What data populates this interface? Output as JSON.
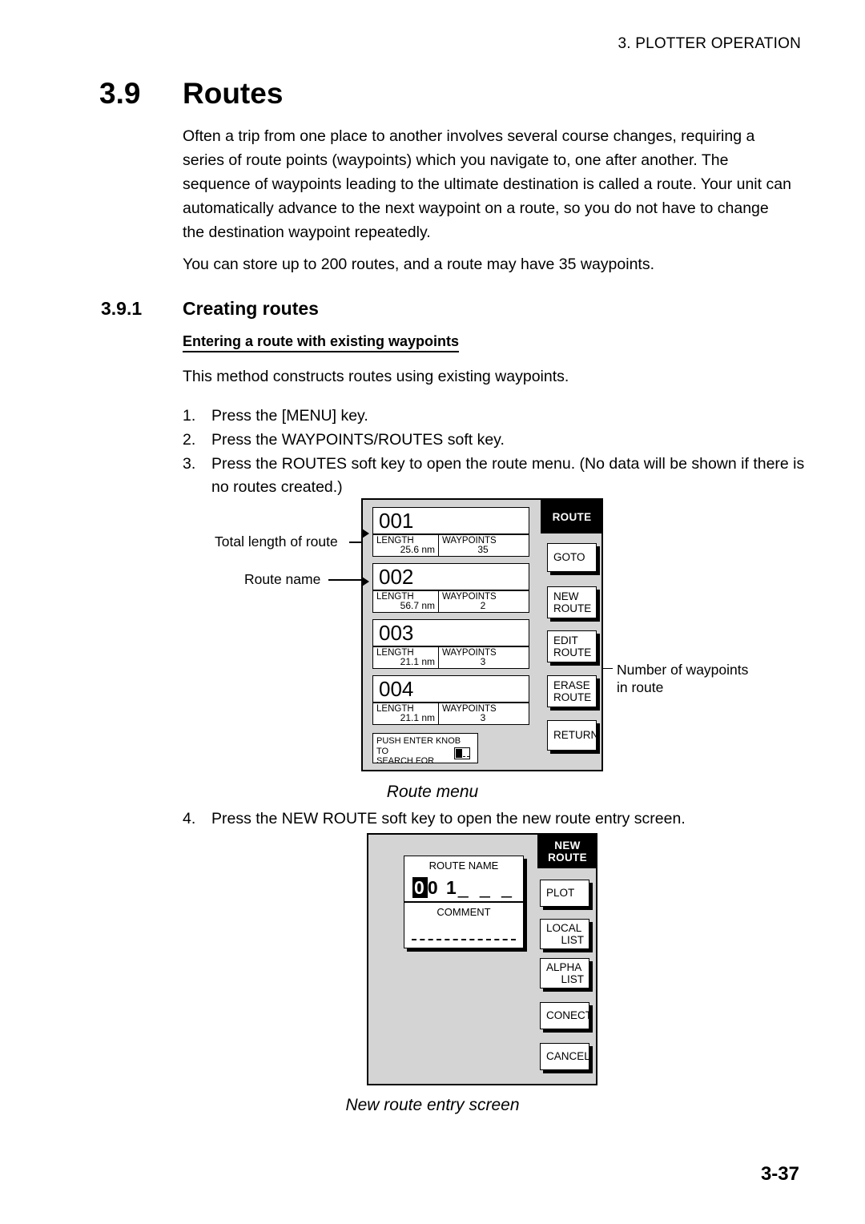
{
  "page": {
    "running_header": "3. PLOTTER OPERATION",
    "page_number": "3-37"
  },
  "section": {
    "number": "3.9",
    "title": "Routes",
    "intro_paragraph": "Often a trip from one place to another involves several course changes, requiring a series of route points (waypoints) which you navigate to, one after another. The sequence of waypoints leading to the ultimate destination is called a route. Your unit can automatically advance to the next waypoint on a route, so you do not have to change the destination waypoint repeatedly.",
    "capacity_paragraph": "You can store up to 200 routes, and a route may have 35 waypoints."
  },
  "subsection": {
    "number": "3.9.1",
    "title": "Creating routes",
    "bold_heading": "Entering a route with existing waypoints",
    "method_paragraph": "This method constructs routes using existing waypoints.",
    "steps": [
      {
        "n": "1.",
        "text": "Press the [MENU] key."
      },
      {
        "n": "2.",
        "text": "Press the WAYPOINTS/ROUTES soft key."
      },
      {
        "n": "3.",
        "text": "Press the ROUTES soft key to open the route menu. (No data will be shown if there is no routes created.)"
      },
      {
        "n": "4.",
        "text": "Press the NEW ROUTE soft key to open the new route entry screen."
      }
    ]
  },
  "route_menu": {
    "caption": "Route menu",
    "title_bar": "ROUTE",
    "column_headers": {
      "length": "LENGTH",
      "waypoints": "WAYPOINTS"
    },
    "routes": [
      {
        "name": "001",
        "length": "25.6 nm",
        "waypoints": "35"
      },
      {
        "name": "002",
        "length": "56.7 nm",
        "waypoints": "2"
      },
      {
        "name": "003",
        "length": "21.1 nm",
        "waypoints": "3"
      },
      {
        "name": "004",
        "length": "21.1 nm",
        "waypoints": "3"
      }
    ],
    "push_enter_line1": "PUSH ENTER KNOB TO",
    "push_enter_line2": "SEARCH FOR",
    "soft_keys": [
      {
        "l1": "GOTO",
        "l2": ""
      },
      {
        "l1": "NEW",
        "l2": "ROUTE"
      },
      {
        "l1": "EDIT",
        "l2": "ROUTE"
      },
      {
        "l1": "ERASE",
        "l2": "ROUTE"
      },
      {
        "l1": "RETURN",
        "l2": ""
      }
    ],
    "callouts": {
      "total_length": "Total length of route",
      "route_name": "Route name",
      "num_waypoints_l1": "Number of waypoints",
      "num_waypoints_l2": "in route"
    }
  },
  "new_route_screen": {
    "caption": "New route entry screen",
    "title_bar_l1": "NEW",
    "title_bar_l2": "ROUTE",
    "route_name_label": "ROUTE NAME",
    "route_name_cursor_char": "0",
    "route_name_rest": "0 1",
    "route_name_blanks": "_ _ _",
    "comment_label": "COMMENT",
    "soft_keys": [
      {
        "l1": "PLOT",
        "l2": ""
      },
      {
        "l1": "LOCAL",
        "l2": "LIST"
      },
      {
        "l1": "ALPHA",
        "l2": "LIST"
      },
      {
        "l1": "CONECT",
        "l2": ""
      },
      {
        "l1": "CANCEL",
        "l2": ""
      }
    ]
  },
  "colors": {
    "panel_bg": "#d4d4d4",
    "bar_bg": "#000000",
    "field_bg": "#ffffff"
  }
}
